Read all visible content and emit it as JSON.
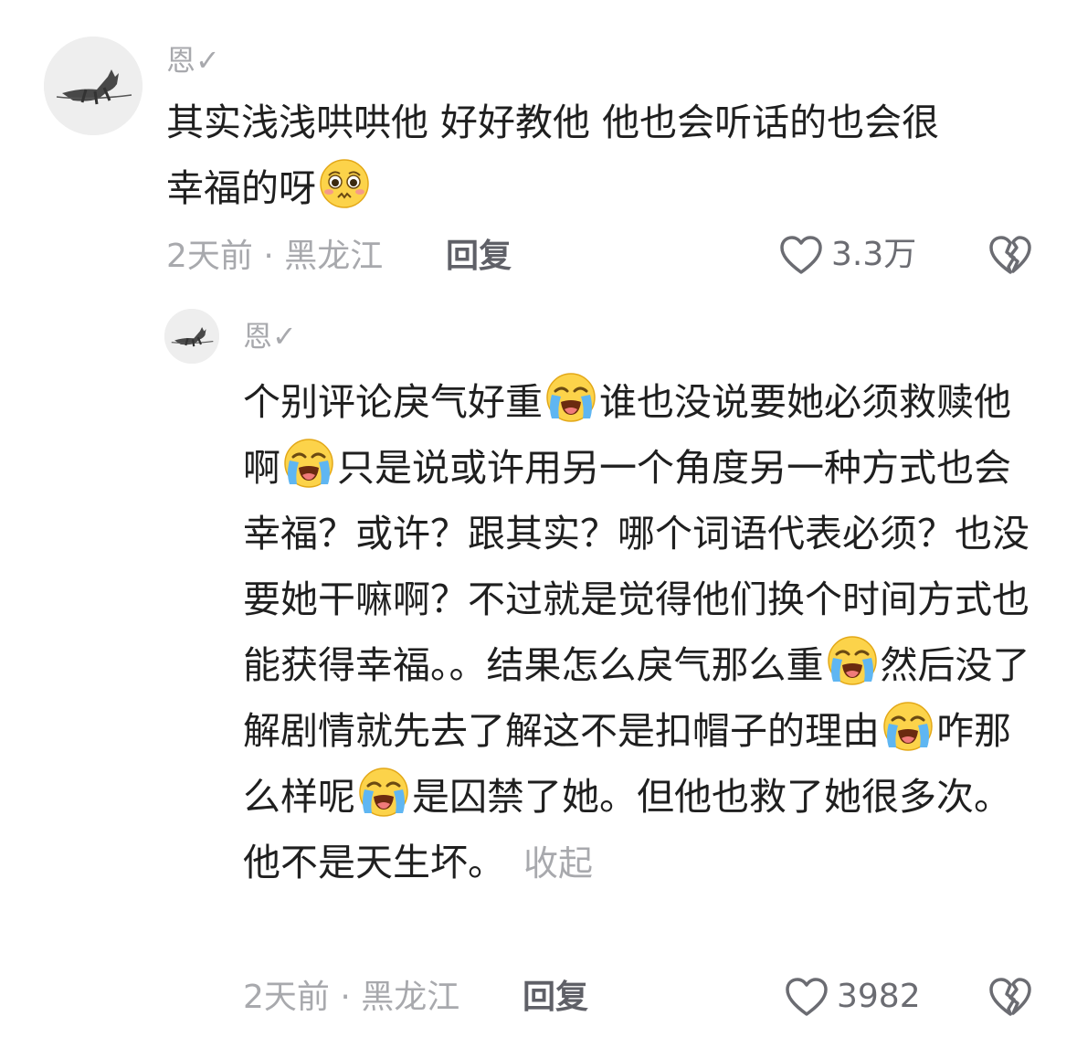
{
  "comments": [
    {
      "username": "恩✓",
      "avatar_icon": "cat-ink-avatar",
      "text_line1": "其实浅浅哄哄他 好好教他 他也会听话的也会很",
      "text_line2": "幸福的呀",
      "emoji": "pleading-face-emoji",
      "time": "2天前",
      "location": "黑龙江",
      "meta_separator": "·",
      "reply_label": "回复",
      "like_count": "3.3万"
    },
    {
      "username": "恩✓",
      "avatar_icon": "cat-ink-avatar",
      "segments": [
        "个别评论戾气好重",
        "谁也没说要她必须救赎他啊",
        "只是说或许用另一个角度另一种方式也会幸福？或许？跟其实？哪个词语代表必须？也没要她干嘛啊？不过就是觉得他们换个时间方式也能获得幸福。。结果怎么戾气那么重",
        "然后没了解剧情就先去了解这不是扣帽子的理由",
        "咋那么样呢",
        "是囚禁了她。但他也救了她很多次。他不是天生坏。"
      ],
      "emoji": "loudly-crying-face-emoji",
      "collapse_label": "收起",
      "time": "2天前",
      "location": "黑龙江",
      "meta_separator": "·",
      "reply_label": "回复",
      "like_count": "3982"
    }
  ],
  "colors": {
    "text": "#1f1f1f",
    "muted": "#a8a9ad",
    "reply": "#5f6067",
    "emoji_yellow": "#fcd34a",
    "tear_blue": "#5fb6f2"
  }
}
